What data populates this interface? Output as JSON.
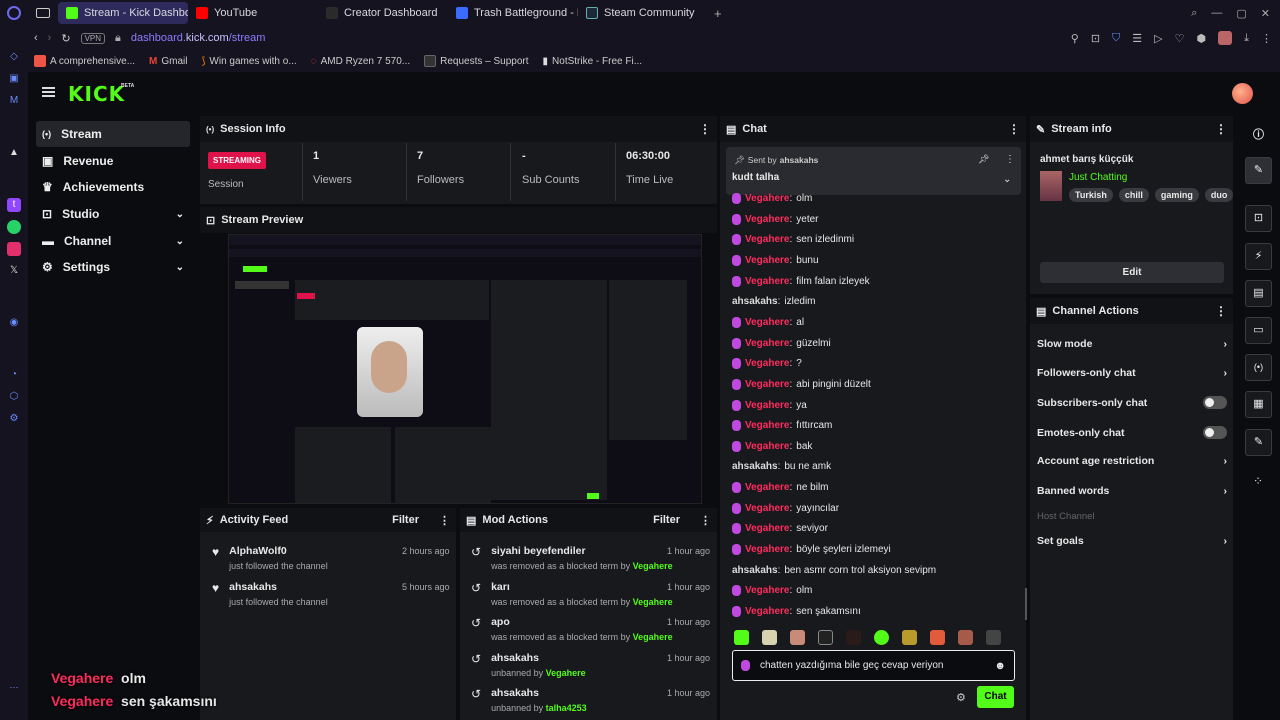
{
  "browser": {
    "tabs": [
      {
        "label": "Stream - Kick Dashboard",
        "color": "#53fc18"
      },
      {
        "label": "YouTube",
        "color": "#ff0000"
      },
      {
        "label": "Creator Dashboard",
        "color": "#2a2a2a"
      },
      {
        "label": "Trash Battleground - Roblox",
        "color": "#3b6cff"
      },
      {
        "label": "Steam Community",
        "color": "#1b2838"
      }
    ],
    "url_host": "dashboard.",
    "url_domain": "kick.com",
    "url_path": "/stream",
    "vpn": "VPN",
    "bookmarks": [
      "A comprehensive...",
      "Gmail",
      "Win games with o...",
      "AMD Ryzen 7 570...",
      "Requests – Support",
      "NotStrike - Free Fi..."
    ]
  },
  "brand": {
    "logo": "KICK",
    "beta": "BETA"
  },
  "nav": [
    {
      "label": "Stream",
      "icon": "stream-icon"
    },
    {
      "label": "Revenue",
      "icon": "revenue-icon"
    },
    {
      "label": "Achievements",
      "icon": "trophy-icon"
    },
    {
      "label": "Studio",
      "icon": "studio-icon",
      "chev": "⌄"
    },
    {
      "label": "Channel",
      "icon": "channel-icon",
      "chev": "⌄"
    },
    {
      "label": "Settings",
      "icon": "gear-icon",
      "chev": "⌄"
    }
  ],
  "session": {
    "title": "Session Info",
    "badge": "STREAMING",
    "session_label": "Session",
    "stats": [
      {
        "value": "1",
        "label": "Viewers"
      },
      {
        "value": "7",
        "label": "Followers"
      },
      {
        "value": "-",
        "label": "Sub Counts"
      },
      {
        "value": "06:30:00",
        "label": "Time Live"
      }
    ]
  },
  "preview": {
    "title": "Stream Preview"
  },
  "activity": {
    "title": "Activity Feed",
    "filter": "Filter",
    "items": [
      {
        "name": "AlphaWolf0",
        "action": "just followed the channel",
        "time": "2 hours ago"
      },
      {
        "name": "ahsakahs",
        "action": "just followed the channel",
        "time": "5 hours ago"
      }
    ]
  },
  "mod": {
    "title": "Mod Actions",
    "filter": "Filter",
    "items": [
      {
        "term": "siyahi beyefendiler",
        "action": "was removed as a blocked term by",
        "by": "Vegahere",
        "time": "1 hour ago"
      },
      {
        "term": "karı",
        "action": "was removed as a blocked term by",
        "by": "Vegahere",
        "time": "1 hour ago"
      },
      {
        "term": "apo",
        "action": "was removed as a blocked term by",
        "by": "Vegahere",
        "time": "1 hour ago"
      },
      {
        "term": "ahsakahs",
        "action": "unbanned by",
        "by": "Vegahere",
        "time": "1 hour ago"
      },
      {
        "term": "ahsakahs",
        "action": "unbanned by",
        "by": "talha4253",
        "time": "1 hour ago"
      }
    ]
  },
  "chat": {
    "title": "Chat",
    "pinned": {
      "sent_by": "Sent by",
      "user": "ahsakahs",
      "text": "kudt talha"
    },
    "messages": [
      {
        "user": "Vegahere",
        "text": "olm",
        "mic": true
      },
      {
        "user": "Vegahere",
        "text": "yeter",
        "mic": true
      },
      {
        "user": "Vegahere",
        "text": "sen izledinmi",
        "mic": true
      },
      {
        "user": "Vegahere",
        "text": "bunu",
        "mic": true
      },
      {
        "user": "Vegahere",
        "text": "film falan izleyek",
        "mic": true
      },
      {
        "user": "ahsakahs",
        "text": "izledim",
        "mic": false
      },
      {
        "user": "Vegahere",
        "text": "al",
        "mic": true
      },
      {
        "user": "Vegahere",
        "text": "güzelmi",
        "mic": true
      },
      {
        "user": "Vegahere",
        "text": "?",
        "mic": true
      },
      {
        "user": "Vegahere",
        "text": "abi pingini düzelt",
        "mic": true
      },
      {
        "user": "Vegahere",
        "text": "ya",
        "mic": true
      },
      {
        "user": "Vegahere",
        "text": "fıttırcam",
        "mic": true
      },
      {
        "user": "Vegahere",
        "text": "bak",
        "mic": true
      },
      {
        "user": "ahsakahs",
        "text": "bu ne amk",
        "mic": false
      },
      {
        "user": "Vegahere",
        "text": "ne bilm",
        "mic": true
      },
      {
        "user": "Vegahere",
        "text": "yayıncılar",
        "mic": true
      },
      {
        "user": "Vegahere",
        "text": "seviyor",
        "mic": true
      },
      {
        "user": "Vegahere",
        "text": "böyle şeyleri izlemeyi",
        "mic": true
      },
      {
        "user": "ahsakahs",
        "text": "ben asmr corn trol aksiyon sevipm",
        "mic": false
      },
      {
        "user": "Vegahere",
        "text": "olm",
        "mic": true
      },
      {
        "user": "Vegahere",
        "text": "sen şakamsını",
        "mic": true
      }
    ],
    "input_value": "chatten yazdığıma bile geç cevap veriyon",
    "send": "Chat"
  },
  "streaminfo": {
    "title": "Stream info",
    "streamer": "ahmet barış küççük",
    "category": "Just Chatting",
    "tags": [
      "Turkish",
      "chill",
      "gaming",
      "duo"
    ],
    "edit": "Edit"
  },
  "actions": {
    "title": "Channel Actions",
    "items": [
      {
        "label": "Slow mode",
        "ctl": "chevron"
      },
      {
        "label": "Followers-only chat",
        "ctl": "chevron"
      },
      {
        "label": "Subscribers-only chat",
        "ctl": "toggle"
      },
      {
        "label": "Emotes-only chat",
        "ctl": "toggle"
      },
      {
        "label": "Account age restriction",
        "ctl": "chevron"
      },
      {
        "label": "Banned words",
        "ctl": "chevron"
      },
      {
        "label": "Host Channel",
        "ctl": "none"
      },
      {
        "label": "Set goals",
        "ctl": "chevron"
      }
    ]
  },
  "overlay": {
    "lines": [
      {
        "user": "Vegahere",
        "text": "olm"
      },
      {
        "user": "Vegahere",
        "text": "sen şakamsını"
      }
    ]
  },
  "colors": {
    "kick_green": "#53fc18",
    "streaming_red": "#e0124a",
    "vega_red": "#ff2b5e"
  }
}
